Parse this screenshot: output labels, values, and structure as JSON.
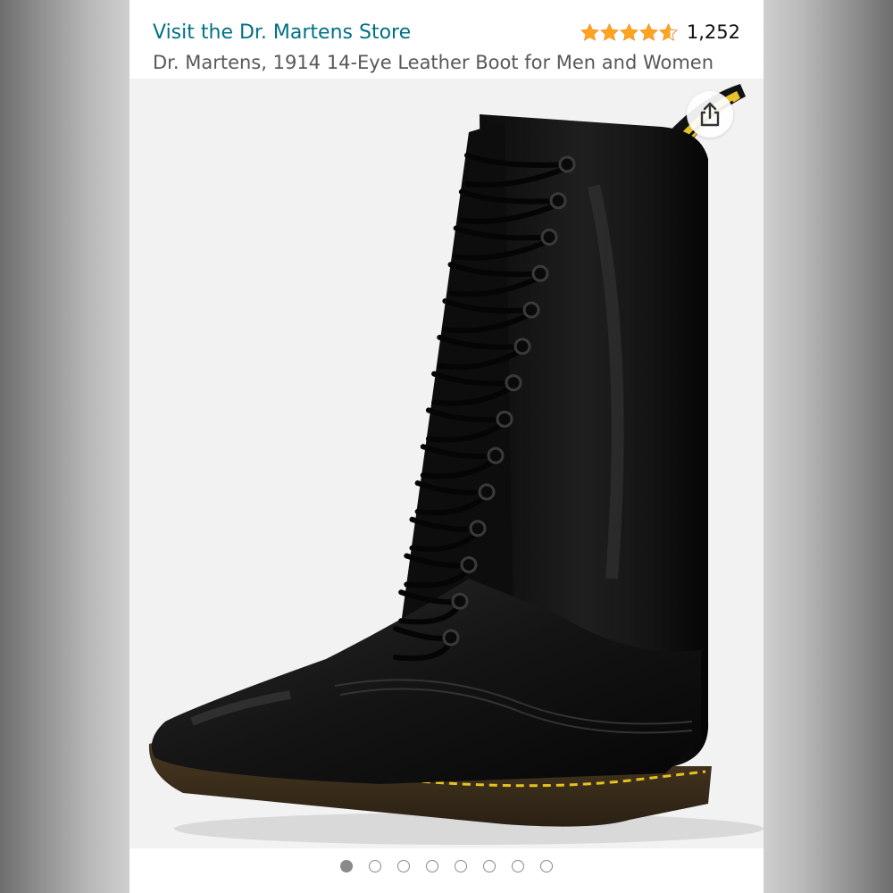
{
  "header": {
    "store_link": "Visit the Dr. Martens Store",
    "rating_value": 4.6,
    "review_count": "1,252"
  },
  "product": {
    "title": "Dr. Martens, 1914 14-Eye Leather Boot for Men and Women"
  },
  "actions": {
    "share_icon": "share-icon"
  },
  "carousel": {
    "total_images": 8,
    "active_index": 0
  },
  "colors": {
    "link": "#007185",
    "star": "#FFA41C",
    "title": "#565959"
  }
}
